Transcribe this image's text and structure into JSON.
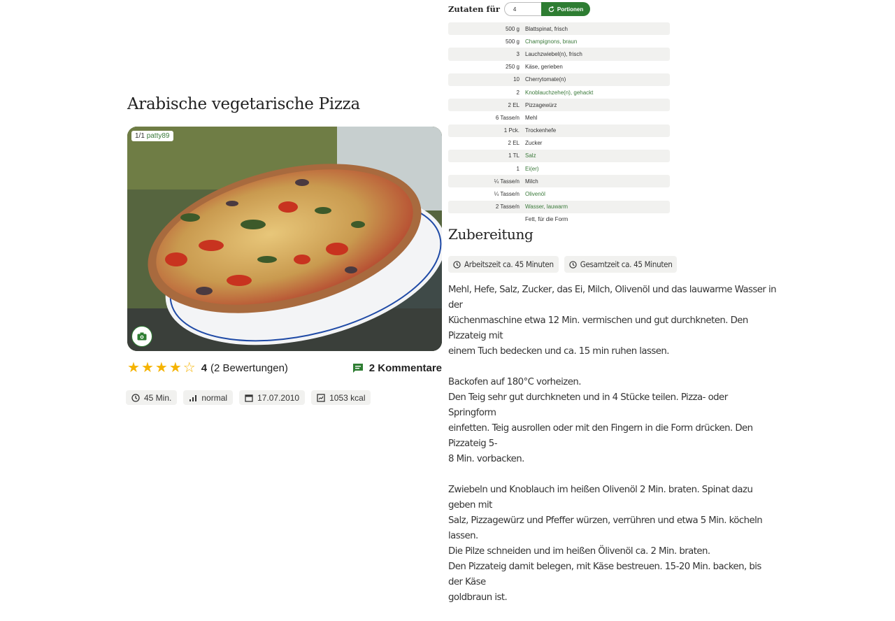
{
  "recipe": {
    "title": "Arabische vegetarische Pizza",
    "photo_credit_index": "1/1",
    "photo_credit_user": "patty89",
    "rating_value": "4",
    "rating_count": "(2 Bewertungen)",
    "comments": "2 Kommentare",
    "stars_filled": 4,
    "stars_total": 5,
    "meta": {
      "time": "45 Min.",
      "difficulty": "normal",
      "date": "17.07.2010",
      "kcal": "1053 kcal"
    }
  },
  "ingredients": {
    "label": "Zutaten für",
    "portions_value": "4",
    "portions_button": "Portionen",
    "items": [
      {
        "amount": "500 g",
        "name": "Blattspinat, frisch",
        "link": false
      },
      {
        "amount": "500 g",
        "name": "Champignons, braun",
        "link": true
      },
      {
        "amount": "3",
        "name": "Lauchzwiebel(n), frisch",
        "link": false
      },
      {
        "amount": "250 g",
        "name": "Käse, gerieben",
        "link": false
      },
      {
        "amount": "10",
        "name": "Cherrytomate(n)",
        "link": false
      },
      {
        "amount": "2",
        "name": "Knoblauchzehe(n), gehackt",
        "link": true
      },
      {
        "amount": "2 EL",
        "name": "Pizzagewürz",
        "link": false
      },
      {
        "amount": "6 Tasse/n",
        "name": "Mehl",
        "link": false
      },
      {
        "amount": "1 Pck.",
        "name": "Trockenhefe",
        "link": false
      },
      {
        "amount": "2 EL",
        "name": "Zucker",
        "link": false
      },
      {
        "amount": "1 TL",
        "name": "Salz",
        "link": true
      },
      {
        "amount": "1",
        "name": "Ei(er)",
        "link": true
      },
      {
        "amount": "¼ Tasse/n",
        "name": "Milch",
        "link": false
      },
      {
        "amount": "¼ Tasse/n",
        "name": "Olivenöl",
        "link": true
      },
      {
        "amount": "2 Tasse/n",
        "name": "Wasser, lauwarm",
        "link": true
      },
      {
        "amount": "",
        "name": "Fett, für die Form",
        "link": false
      }
    ]
  },
  "preparation": {
    "title": "Zubereitung",
    "work_time": "Arbeitszeit ca. 45 Minuten",
    "total_time": "Gesamtzeit ca. 45 Minuten",
    "paragraphs": [
      [
        "Mehl, Hefe, Salz, Zucker, das Ei, Milch, Olivenöl und das lauwarme Wasser in der",
        "Küchenmaschine etwa 12 Min. vermischen und gut durchkneten. Den Pizzateig mit",
        "einem Tuch bedecken und ca. 15 min ruhen lassen."
      ],
      [
        "Backofen auf 180°C vorheizen.",
        "Den Teig sehr gut durchkneten und in 4 Stücke teilen. Pizza- oder Springform",
        "einfetten. Teig ausrollen oder mit den Fingern in die Form drücken. Den Pizzateig 5-",
        "8 Min. vorbacken."
      ],
      [
        "Zwiebeln und Knoblauch im heißen Olivenöl 2 Min. braten. Spinat dazu geben mit",
        "Salz, Pizzagewürz und Pfeffer würzen, verrühren und etwa 5 Min. köcheln lassen.",
        "Die Pilze schneiden und im heißen Ölivenöl ca. 2 Min. braten.",
        "Den Pizzateig damit belegen, mit Käse bestreuen. 15-20 Min. backen, bis der Käse",
        "goldbraun ist."
      ]
    ]
  },
  "colors": {
    "accent_green": "#2e7d32",
    "link_green": "#3b7a3b",
    "star_yellow": "#f5b301",
    "chip_bg": "#f1f1ef"
  }
}
